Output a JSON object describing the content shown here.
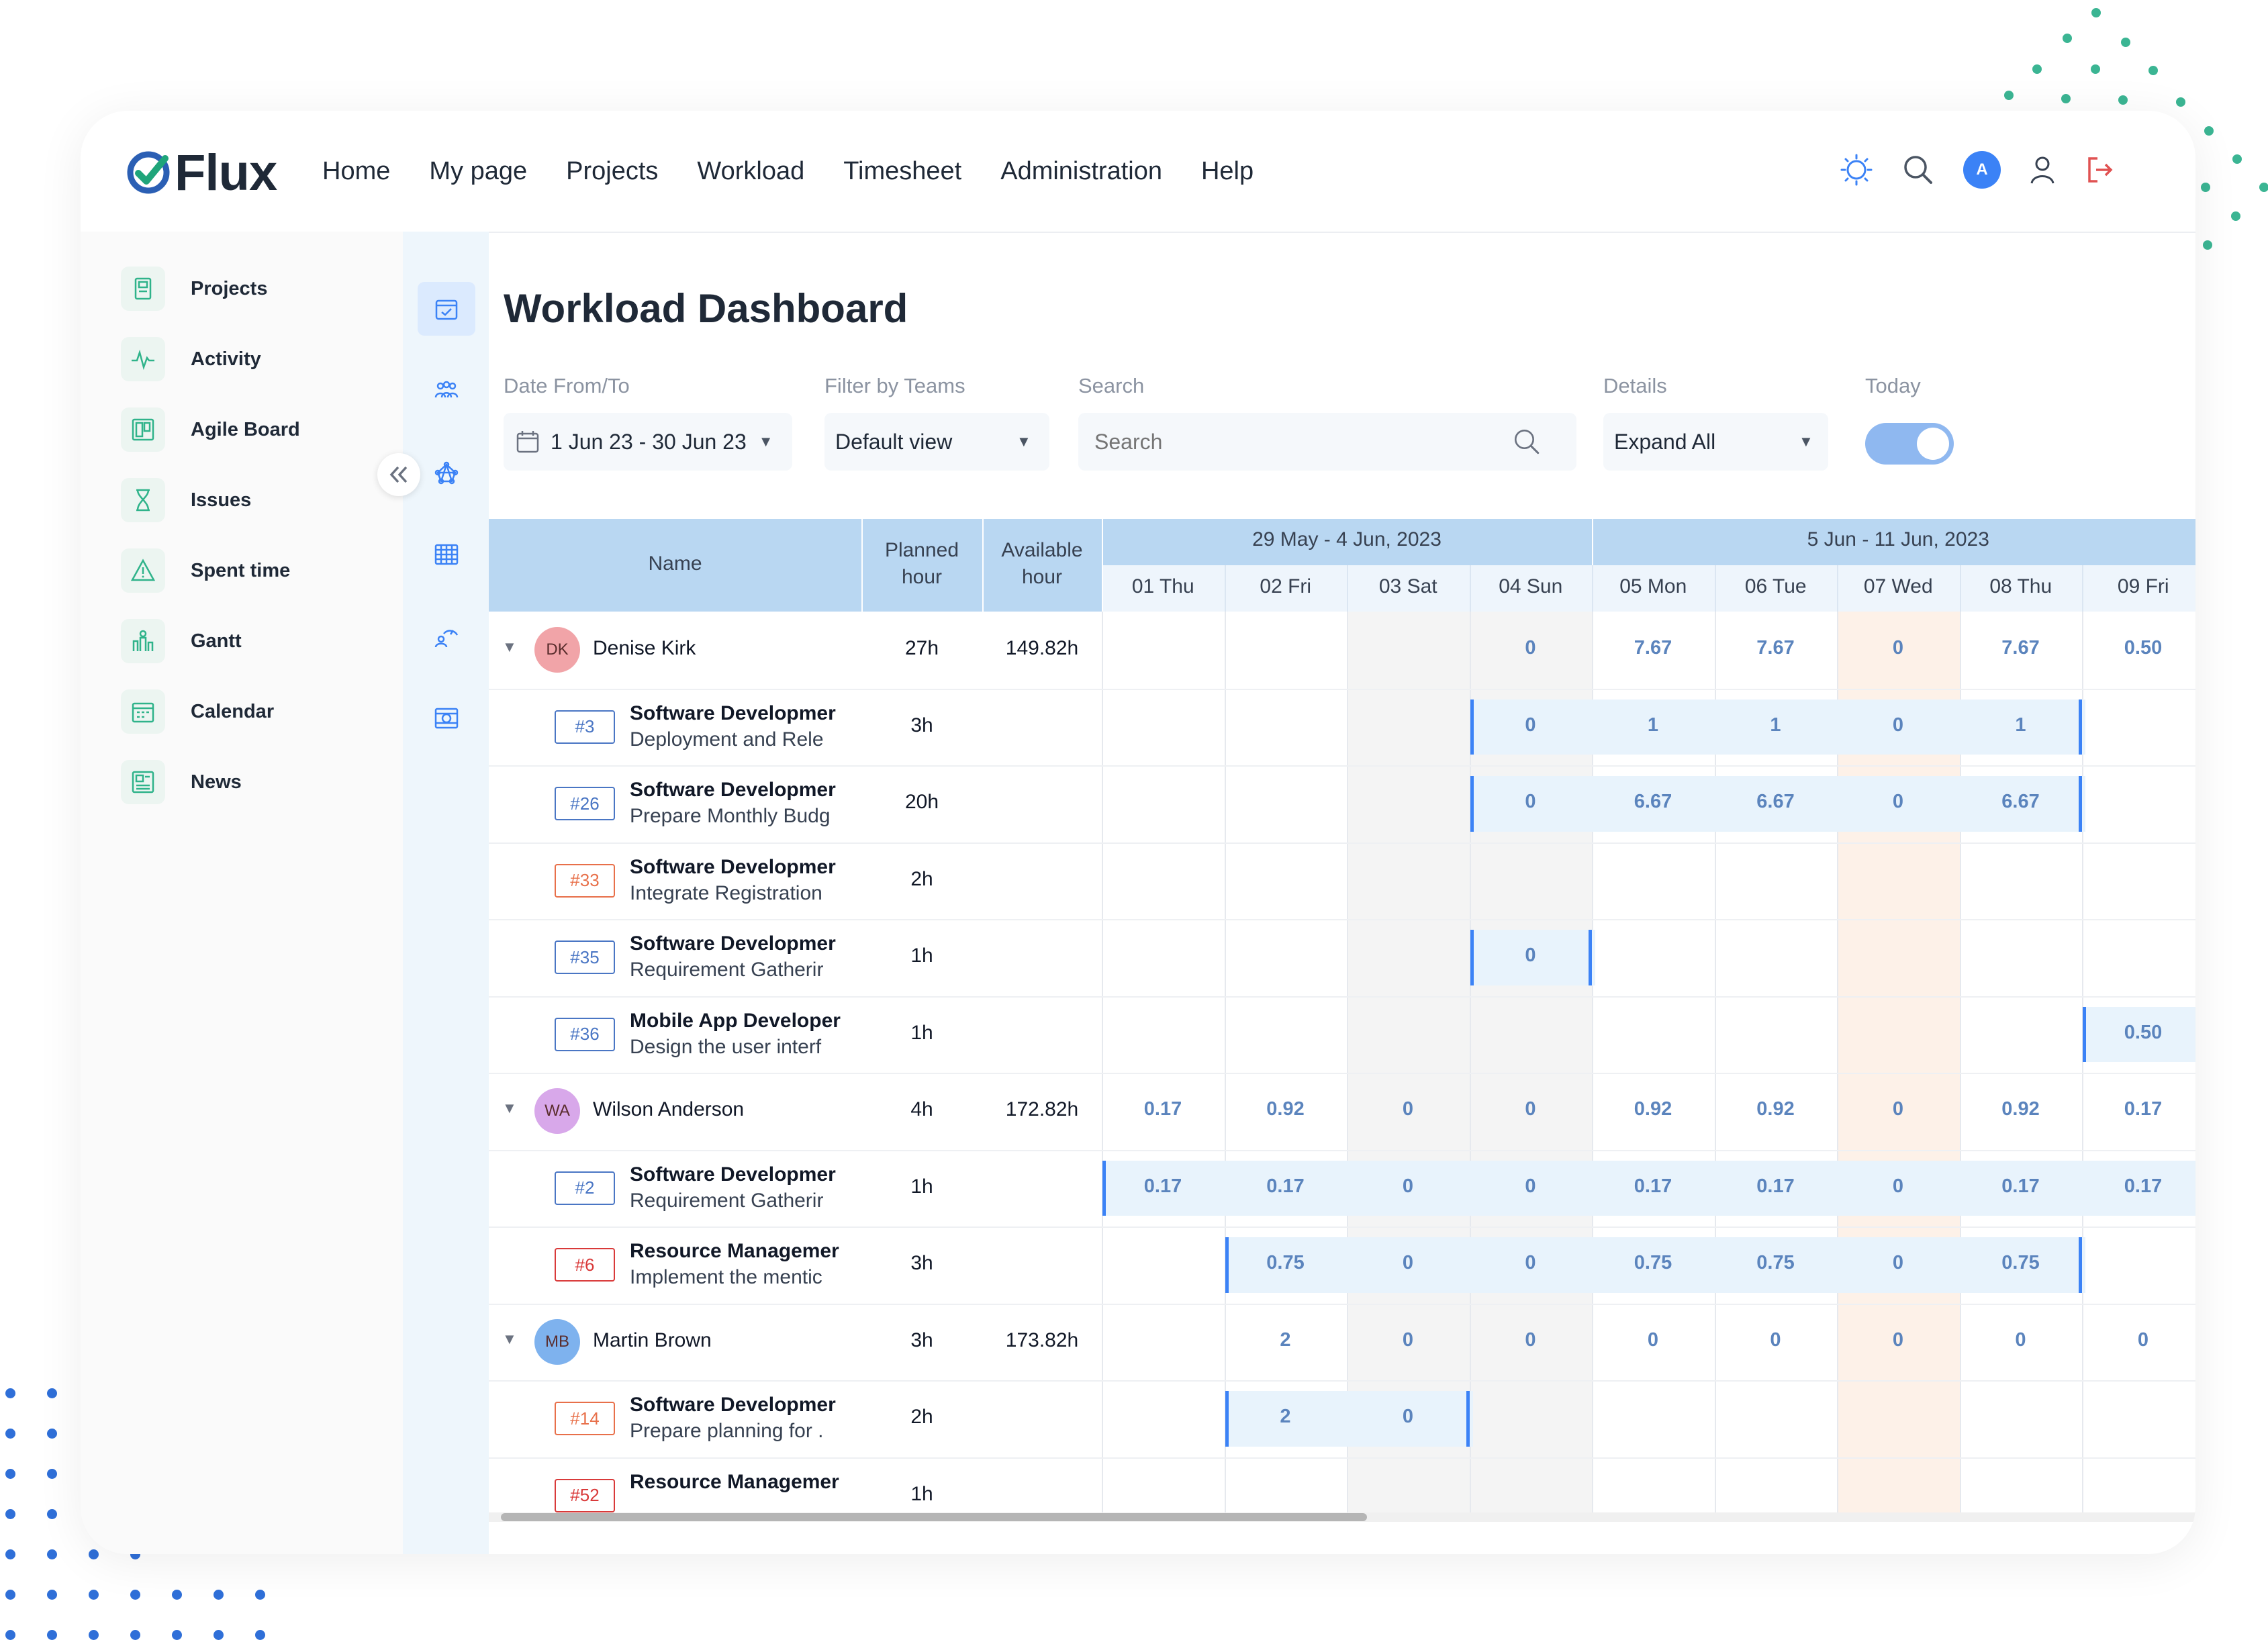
{
  "app": {
    "logo_text": "Flux"
  },
  "nav": [
    "Home",
    "My page",
    "Projects",
    "Workload",
    "Timesheet",
    "Administration",
    "Help"
  ],
  "top_icons": {
    "theme": "sun-icon",
    "search": "search-icon",
    "avatar_initial": "A",
    "user": "user-icon",
    "logout": "logout-icon"
  },
  "sidebar": [
    {
      "label": "Projects",
      "icon": "projects-icon"
    },
    {
      "label": "Activity",
      "icon": "activity-icon"
    },
    {
      "label": "Agile Board",
      "icon": "board-icon"
    },
    {
      "label": "Issues",
      "icon": "hourglass-icon"
    },
    {
      "label": "Spent time",
      "icon": "warning-icon"
    },
    {
      "label": "Gantt",
      "icon": "gantt-icon"
    },
    {
      "label": "Calendar",
      "icon": "calendar-icon"
    },
    {
      "label": "News",
      "icon": "news-icon"
    }
  ],
  "rail_icons": [
    "calendar-check-icon",
    "team-icon",
    "network-icon",
    "table-icon",
    "person-gauge-icon",
    "grid-cog-icon"
  ],
  "page_title": "Workload Dashboard",
  "filters": {
    "date_label": "Date From/To",
    "date_value": "1 Jun 23 - 30 Jun 23",
    "teams_label": "Filter by Teams",
    "teams_value": "Default view",
    "search_label": "Search",
    "search_placeholder": "Search",
    "details_label": "Details",
    "details_value": "Expand All",
    "today_label": "Today",
    "today_on": true
  },
  "table": {
    "headers": {
      "name": "Name",
      "planned_1": "Planned",
      "planned_2": "hour",
      "available_1": "Available",
      "available_2": "hour"
    },
    "weeks": [
      "29 May - 4 Jun, 2023",
      "5 Jun - 11 Jun, 2023"
    ],
    "days": [
      "01 Thu",
      "02 Fri",
      "03 Sat",
      "04 Sun",
      "05 Mon",
      "06 Tue",
      "07 Wed",
      "08 Thu",
      "09 Fri"
    ],
    "rows": [
      {
        "type": "user",
        "initials": "DK",
        "name": "Denise Kirk",
        "planned": "27h",
        "available": "149.82h",
        "avatar_color": "#f1a4a8",
        "values": [
          "",
          "",
          "",
          "0",
          "7.67",
          "7.67",
          "0",
          "7.67",
          "0.50"
        ]
      },
      {
        "type": "task",
        "tag": "#3",
        "tag_color": "blue",
        "title": "Software Developmer",
        "subtitle": "Deployment and Rele",
        "planned": "3h",
        "values": [
          "",
          "",
          "",
          "0",
          "1",
          "1",
          "0",
          "1",
          ""
        ],
        "bar": [
          3,
          7
        ]
      },
      {
        "type": "task",
        "tag": "#26",
        "tag_color": "blue",
        "title": "Software Developmer",
        "subtitle": "Prepare Monthly Budg",
        "planned": "20h",
        "values": [
          "",
          "",
          "",
          "0",
          "6.67",
          "6.67",
          "0",
          "6.67",
          ""
        ],
        "bar": [
          3,
          7
        ]
      },
      {
        "type": "task",
        "tag": "#33",
        "tag_color": "orange",
        "title": "Software Developmer",
        "subtitle": "Integrate Registration",
        "planned": "2h",
        "values": [
          "",
          "",
          "",
          "",
          "",
          "",
          "",
          "",
          ""
        ]
      },
      {
        "type": "task",
        "tag": "#35",
        "tag_color": "blue",
        "title": "Software Developmer",
        "subtitle": "Requirement Gatherir",
        "planned": "1h",
        "values": [
          "",
          "",
          "",
          "0",
          "",
          "",
          "",
          "",
          ""
        ],
        "bar": [
          3,
          3
        ]
      },
      {
        "type": "task",
        "tag": "#36",
        "tag_color": "blue",
        "title": "Mobile App Developer",
        "subtitle": "Design the user interf",
        "planned": "1h",
        "values": [
          "",
          "",
          "",
          "",
          "",
          "",
          "",
          "",
          "0.50"
        ],
        "bar": [
          8,
          8
        ]
      },
      {
        "type": "user",
        "initials": "WA",
        "name": "Wilson Anderson",
        "planned": "4h",
        "available": "172.82h",
        "avatar_color": "#d8a8ea",
        "values": [
          "0.17",
          "0.92",
          "0",
          "0",
          "0.92",
          "0.92",
          "0",
          "0.92",
          "0.17"
        ]
      },
      {
        "type": "task",
        "tag": "#2",
        "tag_color": "blue",
        "title": "Software Developmer",
        "subtitle": "Requirement Gatherir",
        "planned": "1h",
        "values": [
          "0.17",
          "0.17",
          "0",
          "0",
          "0.17",
          "0.17",
          "0",
          "0.17",
          "0.17"
        ],
        "bar": [
          0,
          8
        ]
      },
      {
        "type": "task",
        "tag": "#6",
        "tag_color": "red",
        "title": "Resource Managemer",
        "subtitle": "Implement the mentic",
        "planned": "3h",
        "values": [
          "",
          "0.75",
          "0",
          "0",
          "0.75",
          "0.75",
          "0",
          "0.75",
          ""
        ],
        "bar": [
          1,
          7
        ]
      },
      {
        "type": "user",
        "initials": "MB",
        "name": "Martin Brown",
        "planned": "3h",
        "available": "173.82h",
        "avatar_color": "#7eb2ee",
        "values": [
          "",
          "2",
          "0",
          "0",
          "0",
          "0",
          "0",
          "0",
          "0"
        ]
      },
      {
        "type": "task",
        "tag": "#14",
        "tag_color": "orange",
        "title": "Software Developmer",
        "subtitle": "Prepare planning for .",
        "planned": "2h",
        "values": [
          "",
          "2",
          "0",
          "",
          "",
          "",
          "",
          "",
          ""
        ],
        "bar": [
          1,
          2
        ]
      },
      {
        "type": "task",
        "tag": "#52",
        "tag_color": "red",
        "title": "Resource Managemer",
        "subtitle": "",
        "planned": "1h",
        "values": [
          "",
          "",
          "",
          "",
          "",
          "",
          "",
          "",
          ""
        ]
      }
    ]
  },
  "colors": {
    "accent": "#3b82f6",
    "header_bg": "#b9d7f2",
    "bar_bg": "#e8f3fc",
    "today_bg": "#fdf1e8",
    "logo_green": "#1fa57a"
  }
}
